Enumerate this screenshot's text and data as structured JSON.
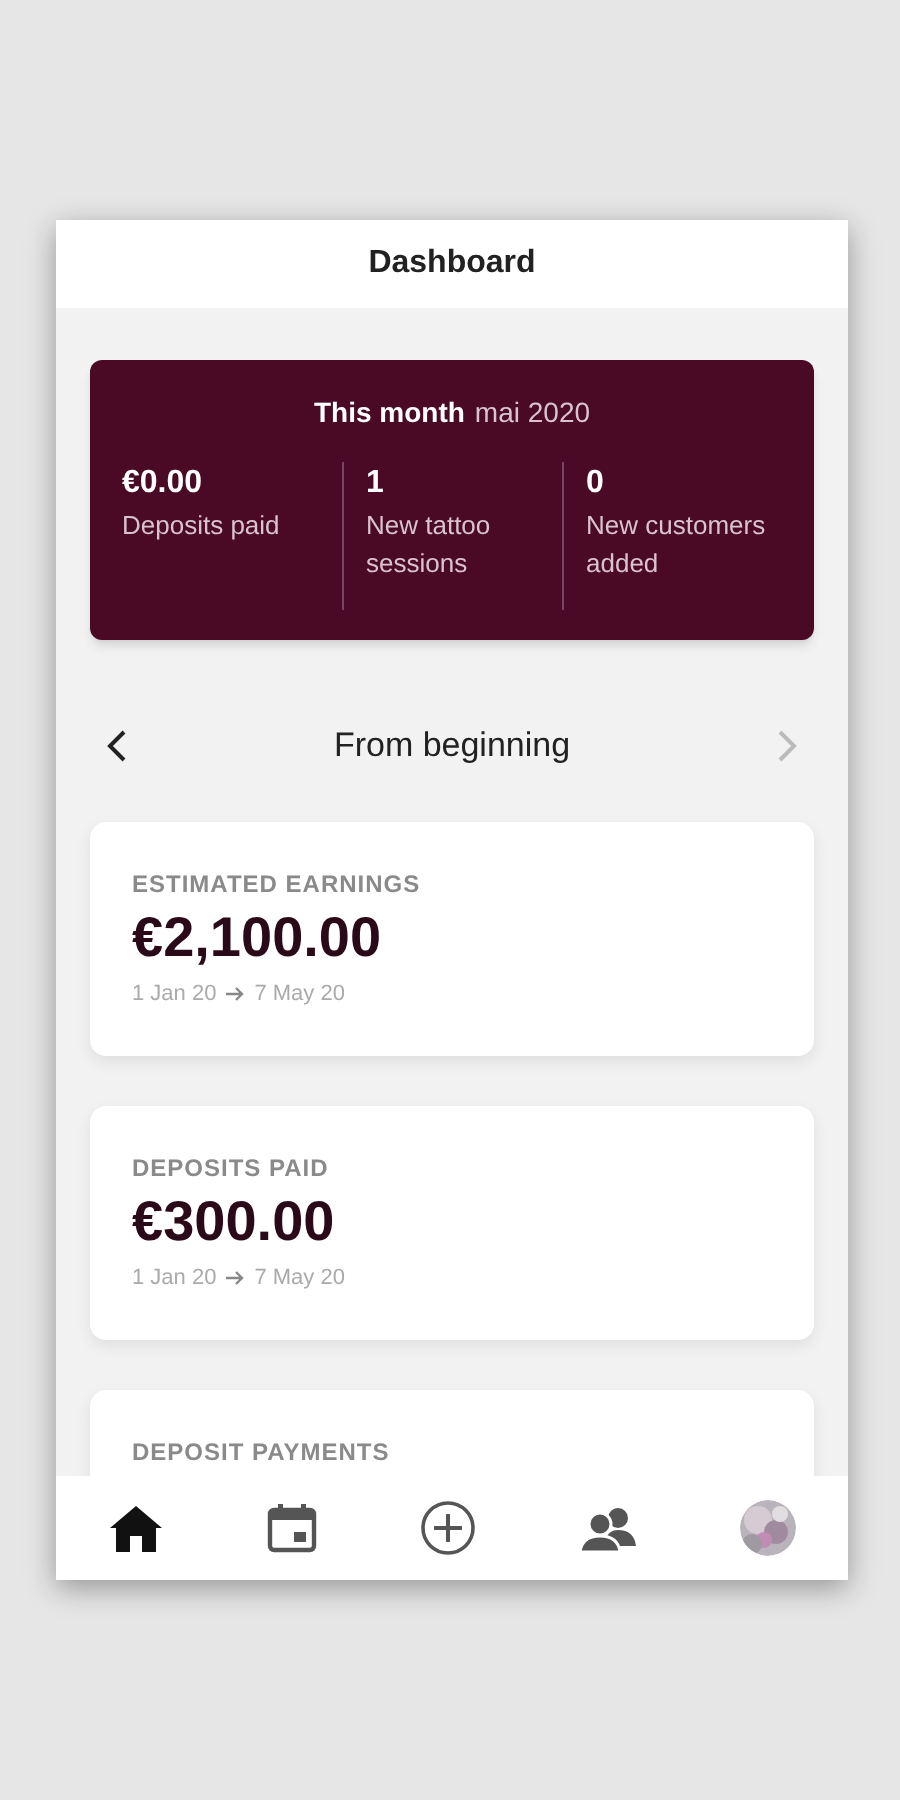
{
  "header": {
    "title": "Dashboard"
  },
  "month_summary": {
    "title": "This month",
    "month": "mai 2020",
    "stats": [
      {
        "value": "€0.00",
        "label": "Deposits paid"
      },
      {
        "value": "1",
        "label": "New tattoo sessions"
      },
      {
        "value": "0",
        "label": "New customers added"
      }
    ]
  },
  "period": {
    "label": "From beginning",
    "prev_disabled": false,
    "next_disabled": true
  },
  "cards": [
    {
      "title": "ESTIMATED EARNINGS",
      "amount": "€2,100.00",
      "from": "1 Jan 20",
      "to": "7 May 20"
    },
    {
      "title": "DEPOSITS PAID",
      "amount": "€300.00",
      "from": "1 Jan 20",
      "to": "7 May 20"
    },
    {
      "title": "DEPOSIT PAYMENTS"
    }
  ],
  "nav": [
    {
      "kind": "home",
      "selected": true
    },
    {
      "kind": "calendar",
      "selected": false
    },
    {
      "kind": "add",
      "selected": false
    },
    {
      "kind": "customers",
      "selected": false
    },
    {
      "kind": "avatar",
      "selected": false
    }
  ]
}
